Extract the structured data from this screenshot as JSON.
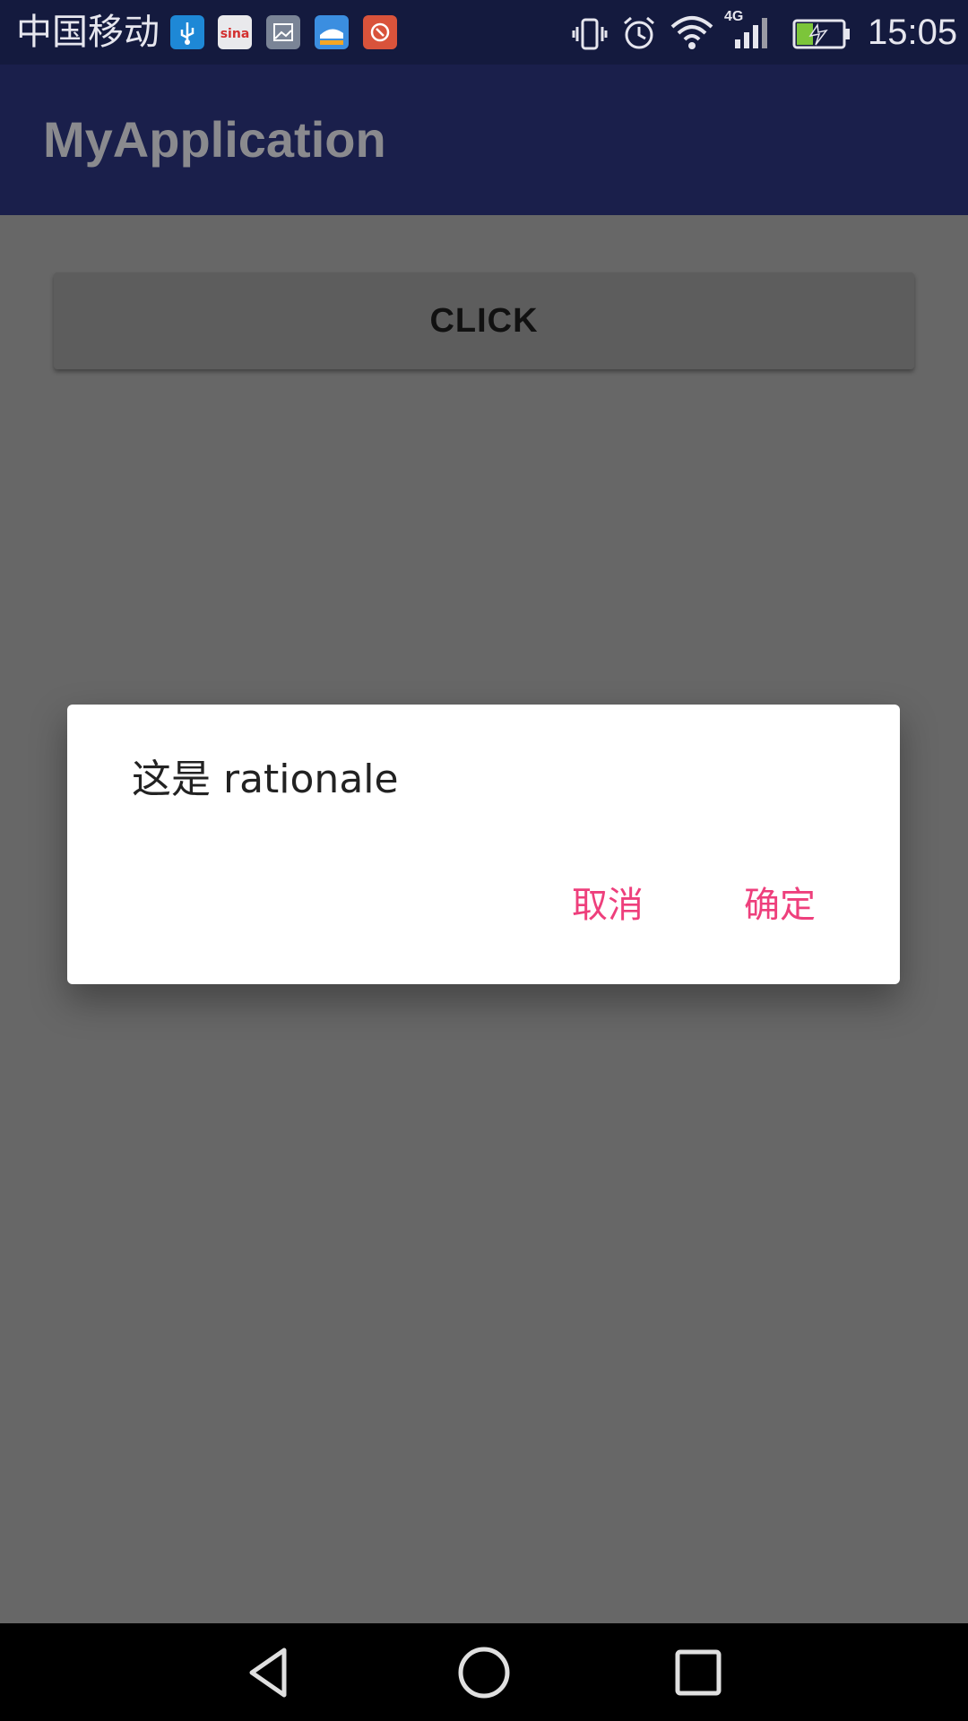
{
  "status_bar": {
    "carrier": "中国移动",
    "network_type": "4G",
    "time": "15:05",
    "notification_icons": [
      "usb-icon",
      "sina-icon",
      "gallery-icon",
      "train-app-icon",
      "recorder-app-icon"
    ],
    "status_icons": [
      "vibrate-icon",
      "alarm-icon",
      "wifi-icon",
      "signal-icon",
      "battery-charging-icon"
    ]
  },
  "app_bar": {
    "title": "MyApplication"
  },
  "main": {
    "click_button_label": "CLICK"
  },
  "dialog": {
    "message": "这是 rationale",
    "cancel_label": "取消",
    "ok_label": "确定",
    "accent_color": "#ee3f7c"
  },
  "nav_bar": {
    "buttons": [
      "back-icon",
      "home-icon",
      "recents-icon"
    ]
  }
}
